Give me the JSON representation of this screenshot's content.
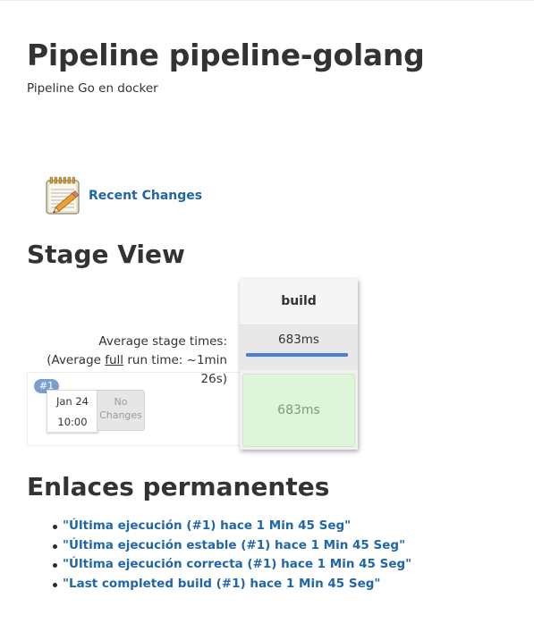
{
  "page": {
    "title": "Pipeline pipeline-golang",
    "description": "Pipeline Go en docker"
  },
  "recent_changes": {
    "icon": "notepad-pencil-icon",
    "label": "Recent Changes"
  },
  "stage_view": {
    "heading": "Stage View",
    "avg_label": "Average stage times:",
    "avg_full_prefix": "(Average ",
    "avg_full_word": "full",
    "avg_full_suffix": " run time: ~1min",
    "avg_full_time_tail": "26s)",
    "stages": [
      {
        "name": "build",
        "avg_time": "683ms"
      }
    ],
    "runs": [
      {
        "badge": "#1",
        "date": "Jan 24",
        "time": "10:00",
        "changes_line1": "No",
        "changes_line2": "Changes",
        "stage_times": [
          "683ms"
        ]
      }
    ],
    "colors": {
      "success_cell": "#dff5d9",
      "avg_bar": "#4a80d9",
      "badge": "#7a9ed0"
    }
  },
  "permalinks": {
    "heading": "Enlaces permanentes",
    "items": [
      "\"Última ejecución (#1) hace 1 Min 45 Seg\"",
      "\"Última ejecución estable (#1) hace 1 Min 45 Seg\"",
      "\"Última ejecución correcta (#1) hace 1 Min 45 Seg\"",
      "\"Last completed build (#1) hace 1 Min 45 Seg\""
    ]
  },
  "theme": {
    "link_color": "#2066a8",
    "text_color": "#333333"
  }
}
